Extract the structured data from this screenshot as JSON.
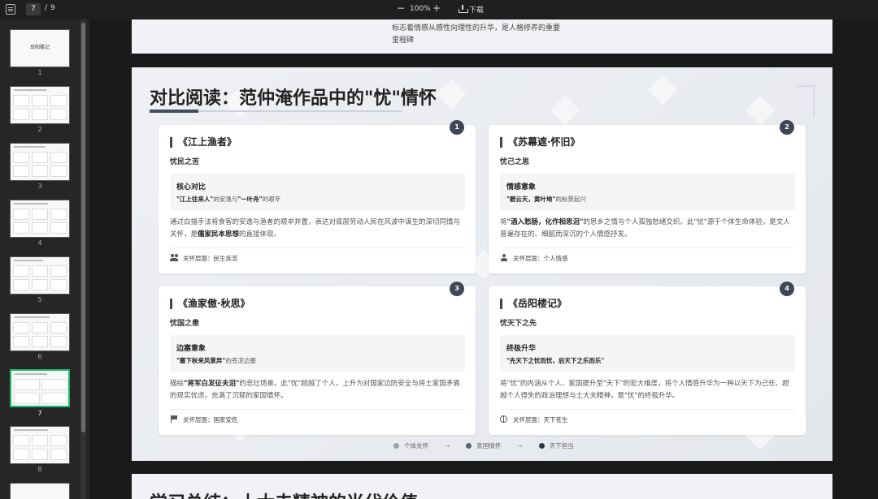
{
  "toolbar": {
    "current_page": "7",
    "page_sep": "/",
    "total_pages": "9",
    "zoom_out": "−",
    "zoom": "100%",
    "zoom_in": "+",
    "download": "下载"
  },
  "thumbnails": [
    {
      "num": "1",
      "title": "岳阳楼记"
    },
    {
      "num": "2"
    },
    {
      "num": "3"
    },
    {
      "num": "4"
    },
    {
      "num": "5"
    },
    {
      "num": "6"
    },
    {
      "num": "7"
    },
    {
      "num": "8"
    }
  ],
  "prev_slide": {
    "line1": "标志着情感从感性向理性的升华，是人格修养的重要",
    "line2": "里程碑"
  },
  "slide": {
    "title": "对比阅读：范仲淹作品中的\"忧\"情怀",
    "cards": [
      {
        "badge": "1",
        "title": "《江上渔者》",
        "subtitle": "忧民之苦",
        "box_head": "核心对比",
        "box_q1": "\"江上往来人\"",
        "box_m1": "的安逸与",
        "box_q2": "\"一叶舟\"",
        "box_m2": "的艰辛",
        "body_a": "通过白描手法将食客的安逸与渔者的艰辛并置，表达对底层劳动人民在风波中谋生的深切同情与关怀，是",
        "body_b": "儒家民本思想",
        "body_c": "的直接体现。",
        "foot_label": "关怀层面：",
        "foot_value": "民生疾苦",
        "icon": "people-icon"
      },
      {
        "badge": "2",
        "title": "《苏幕遮·怀旧》",
        "subtitle": "忧己之思",
        "box_head": "情感意象",
        "box_q1": "\"碧云天，黄叶地\"",
        "box_m1": "的秋景起兴",
        "box_q2": "",
        "box_m2": "",
        "body_a": "将",
        "body_b": "\"酒入愁肠，化作相思泪\"",
        "body_c": "的思乡之情与个人孤独愁绪交织。此\"忧\"源于个体生命体验，是文人普遍存在的、细腻而深沉的个人情感抒发。",
        "foot_label": "关怀层面：",
        "foot_value": "个人情感",
        "icon": "person-icon"
      },
      {
        "badge": "3",
        "title": "《渔家傲·秋思》",
        "subtitle": "忧国之患",
        "box_head": "边塞意象",
        "box_q1": "\"塞下秋来风景异\"",
        "box_m1": "的苍凉边塞",
        "box_q2": "",
        "box_m2": "",
        "body_a": "描绘",
        "body_b": "\"将军白发征夫泪\"",
        "body_c": "的悲壮场景。此\"忧\"超越了个人，上升为对国家边防安全与将士家国矛盾的现实忧虑，充满了沉郁的家国情怀。",
        "foot_label": "关怀层面：",
        "foot_value": "国家安危",
        "icon": "flag-icon"
      },
      {
        "badge": "4",
        "title": "《岳阳楼记》",
        "subtitle": "忧天下之先",
        "box_head": "终极升华",
        "box_q1": "\"先天下之忧而忧，后天下之乐而乐\"",
        "box_m1": "",
        "box_q2": "",
        "box_m2": "",
        "body_a": "将\"忧\"的内涵从个人、家国提升至\"天下\"的宏大维度，将个人情感升华为一种以天下为己任、超越个人得失的政治理想与士大夫精神，是\"忧\"的终极升华。",
        "body_b": "",
        "body_c": "",
        "foot_label": "关怀层面：",
        "foot_value": "天下苍生",
        "icon": "globe-icon"
      }
    ],
    "legend": [
      {
        "label": "个体关怀",
        "color": "#9aa1ad"
      },
      {
        "label": "家国情怀",
        "color": "#5d6575"
      },
      {
        "label": "天下担当",
        "color": "#2f3644"
      }
    ],
    "legend_arrow": "→"
  },
  "next_slide": {
    "title": "学习总结：士大夫精神的当代价值"
  }
}
